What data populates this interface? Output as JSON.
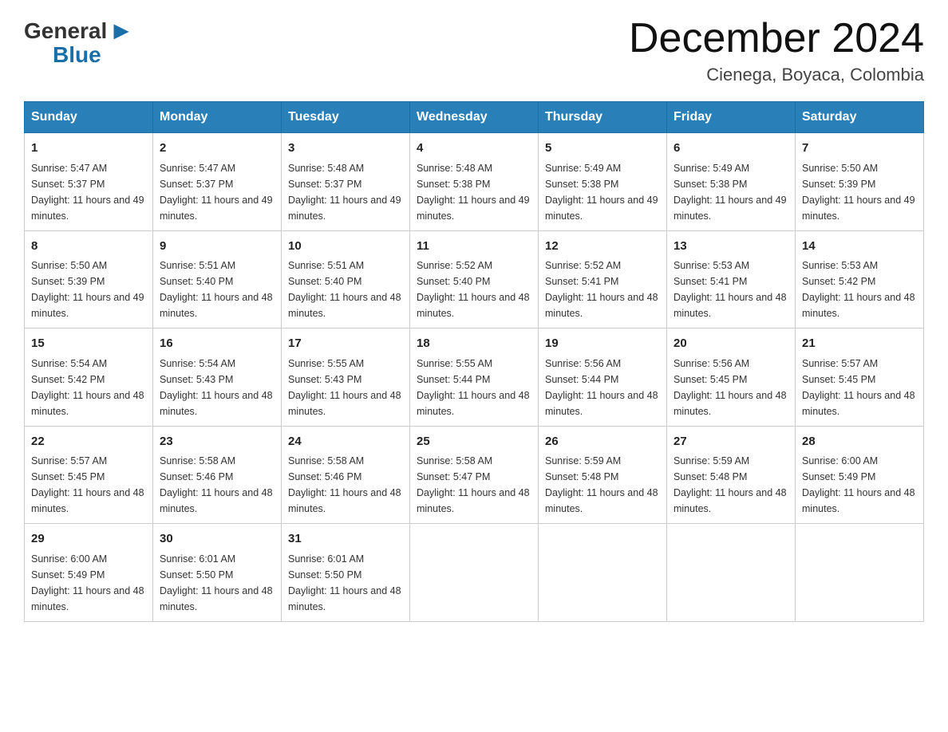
{
  "logo": {
    "general": "General",
    "blue": "Blue"
  },
  "title": "December 2024",
  "subtitle": "Cienega, Boyaca, Colombia",
  "weekdays": [
    "Sunday",
    "Monday",
    "Tuesday",
    "Wednesday",
    "Thursday",
    "Friday",
    "Saturday"
  ],
  "weeks": [
    [
      {
        "day": "1",
        "sunrise": "5:47 AM",
        "sunset": "5:37 PM",
        "daylight": "11 hours and 49 minutes."
      },
      {
        "day": "2",
        "sunrise": "5:47 AM",
        "sunset": "5:37 PM",
        "daylight": "11 hours and 49 minutes."
      },
      {
        "day": "3",
        "sunrise": "5:48 AM",
        "sunset": "5:37 PM",
        "daylight": "11 hours and 49 minutes."
      },
      {
        "day": "4",
        "sunrise": "5:48 AM",
        "sunset": "5:38 PM",
        "daylight": "11 hours and 49 minutes."
      },
      {
        "day": "5",
        "sunrise": "5:49 AM",
        "sunset": "5:38 PM",
        "daylight": "11 hours and 49 minutes."
      },
      {
        "day": "6",
        "sunrise": "5:49 AM",
        "sunset": "5:38 PM",
        "daylight": "11 hours and 49 minutes."
      },
      {
        "day": "7",
        "sunrise": "5:50 AM",
        "sunset": "5:39 PM",
        "daylight": "11 hours and 49 minutes."
      }
    ],
    [
      {
        "day": "8",
        "sunrise": "5:50 AM",
        "sunset": "5:39 PM",
        "daylight": "11 hours and 49 minutes."
      },
      {
        "day": "9",
        "sunrise": "5:51 AM",
        "sunset": "5:40 PM",
        "daylight": "11 hours and 48 minutes."
      },
      {
        "day": "10",
        "sunrise": "5:51 AM",
        "sunset": "5:40 PM",
        "daylight": "11 hours and 48 minutes."
      },
      {
        "day": "11",
        "sunrise": "5:52 AM",
        "sunset": "5:40 PM",
        "daylight": "11 hours and 48 minutes."
      },
      {
        "day": "12",
        "sunrise": "5:52 AM",
        "sunset": "5:41 PM",
        "daylight": "11 hours and 48 minutes."
      },
      {
        "day": "13",
        "sunrise": "5:53 AM",
        "sunset": "5:41 PM",
        "daylight": "11 hours and 48 minutes."
      },
      {
        "day": "14",
        "sunrise": "5:53 AM",
        "sunset": "5:42 PM",
        "daylight": "11 hours and 48 minutes."
      }
    ],
    [
      {
        "day": "15",
        "sunrise": "5:54 AM",
        "sunset": "5:42 PM",
        "daylight": "11 hours and 48 minutes."
      },
      {
        "day": "16",
        "sunrise": "5:54 AM",
        "sunset": "5:43 PM",
        "daylight": "11 hours and 48 minutes."
      },
      {
        "day": "17",
        "sunrise": "5:55 AM",
        "sunset": "5:43 PM",
        "daylight": "11 hours and 48 minutes."
      },
      {
        "day": "18",
        "sunrise": "5:55 AM",
        "sunset": "5:44 PM",
        "daylight": "11 hours and 48 minutes."
      },
      {
        "day": "19",
        "sunrise": "5:56 AM",
        "sunset": "5:44 PM",
        "daylight": "11 hours and 48 minutes."
      },
      {
        "day": "20",
        "sunrise": "5:56 AM",
        "sunset": "5:45 PM",
        "daylight": "11 hours and 48 minutes."
      },
      {
        "day": "21",
        "sunrise": "5:57 AM",
        "sunset": "5:45 PM",
        "daylight": "11 hours and 48 minutes."
      }
    ],
    [
      {
        "day": "22",
        "sunrise": "5:57 AM",
        "sunset": "5:45 PM",
        "daylight": "11 hours and 48 minutes."
      },
      {
        "day": "23",
        "sunrise": "5:58 AM",
        "sunset": "5:46 PM",
        "daylight": "11 hours and 48 minutes."
      },
      {
        "day": "24",
        "sunrise": "5:58 AM",
        "sunset": "5:46 PM",
        "daylight": "11 hours and 48 minutes."
      },
      {
        "day": "25",
        "sunrise": "5:58 AM",
        "sunset": "5:47 PM",
        "daylight": "11 hours and 48 minutes."
      },
      {
        "day": "26",
        "sunrise": "5:59 AM",
        "sunset": "5:48 PM",
        "daylight": "11 hours and 48 minutes."
      },
      {
        "day": "27",
        "sunrise": "5:59 AM",
        "sunset": "5:48 PM",
        "daylight": "11 hours and 48 minutes."
      },
      {
        "day": "28",
        "sunrise": "6:00 AM",
        "sunset": "5:49 PM",
        "daylight": "11 hours and 48 minutes."
      }
    ],
    [
      {
        "day": "29",
        "sunrise": "6:00 AM",
        "sunset": "5:49 PM",
        "daylight": "11 hours and 48 minutes."
      },
      {
        "day": "30",
        "sunrise": "6:01 AM",
        "sunset": "5:50 PM",
        "daylight": "11 hours and 48 minutes."
      },
      {
        "day": "31",
        "sunrise": "6:01 AM",
        "sunset": "5:50 PM",
        "daylight": "11 hours and 48 minutes."
      },
      null,
      null,
      null,
      null
    ]
  ]
}
